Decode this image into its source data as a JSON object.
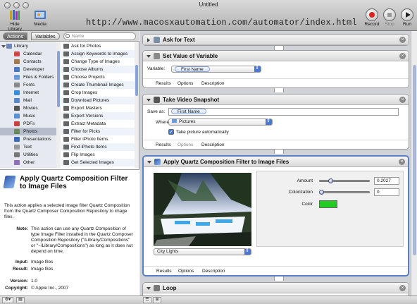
{
  "window": {
    "title": "Untitled"
  },
  "toolbar": {
    "hide_library_label": "Hide Library",
    "media_label": "Media",
    "url_text": "http://www.macosxautomation.com/automator/index.html",
    "record_label": "Record",
    "stop_label": "Stop",
    "run_label": "Run"
  },
  "library": {
    "tabs": {
      "actions": "Actions",
      "variables": "Variables"
    },
    "search_placeholder": "Name",
    "categories": [
      {
        "label": "Library",
        "icon": "library-icon",
        "color": "#6d88b8",
        "top": true
      },
      {
        "label": "Calendar",
        "icon": "calendar-icon",
        "color": "#d04545"
      },
      {
        "label": "Contacts",
        "icon": "contacts-icon",
        "color": "#a57a4e"
      },
      {
        "label": "Developer",
        "icon": "developer-icon",
        "color": "#4d78c0"
      },
      {
        "label": "Files & Folders",
        "icon": "folder-icon",
        "color": "#6a9ad8"
      },
      {
        "label": "Fonts",
        "icon": "fonts-icon",
        "color": "#888888"
      },
      {
        "label": "Internet",
        "icon": "internet-icon",
        "color": "#3a8ed8"
      },
      {
        "label": "Mail",
        "icon": "mail-icon",
        "color": "#5a87c8"
      },
      {
        "label": "Movies",
        "icon": "movies-icon",
        "color": "#555555"
      },
      {
        "label": "Music",
        "icon": "music-icon",
        "color": "#5a8fd0"
      },
      {
        "label": "PDFs",
        "icon": "pdf-icon",
        "color": "#c84040"
      },
      {
        "label": "Photos",
        "icon": "photos-icon",
        "color": "#6a8a5a",
        "selected": true
      },
      {
        "label": "Presentations",
        "icon": "presentations-icon",
        "color": "#3a6ab8"
      },
      {
        "label": "Text",
        "icon": "text-icon",
        "color": "#999999"
      },
      {
        "label": "Utilities",
        "icon": "utilities-icon",
        "color": "#777777"
      },
      {
        "label": "Other",
        "icon": "other-icon",
        "color": "#8f6fb8"
      }
    ],
    "actions": [
      "Ask for Photos",
      "Assign Keywords to Images",
      "Change Type of Images",
      "Choose Albums",
      "Choose Projects",
      "Create Thumbnail Images",
      "Crop Images",
      "Download Pictures",
      "Export Masters",
      "Export Versions",
      "Extract Metadata",
      "Filter for Picks",
      "Filter iPhoto Items",
      "Find iPhoto Items",
      "Flip Images",
      "Get Selected Images"
    ]
  },
  "description": {
    "title": "Apply Quartz Composition Filter to Image Files",
    "body": "This action applies a selected image filter Quartz Composition from the Quartz Composer Composition Repository to image files.",
    "note_label": "Note:",
    "note": "This action can use any Quartz Composition of type Image Filter installed in the Quartz Composer Composition Repository (\"/Library/Compositions\" or \"~/Library/Compositions\") as long as it does not depend on time.",
    "input_label": "Input:",
    "input": "Image files",
    "result_label": "Result:",
    "result": "Image files",
    "version_label": "Version:",
    "version": "1.0",
    "copyright_label": "Copyright:",
    "copyright": "© Apple Inc., 2007"
  },
  "workflow": {
    "footer_tabs": {
      "results": "Results",
      "options": "Options",
      "description": "Description"
    },
    "ask_for_text": {
      "title": "Ask for Text"
    },
    "set_variable": {
      "title": "Set Value of Variable",
      "variable_label": "Variable:",
      "variable_value": "First Name"
    },
    "take_snapshot": {
      "title": "Take Video Snapshot",
      "save_as_label": "Save as:",
      "save_as_value": "First Name",
      "where_label": "Where:",
      "where_value": "Pictures",
      "checkbox_label": "Take picture automatically",
      "checkbox_checked": true
    },
    "quartz_filter": {
      "title": "Apply Quartz Composition Filter to Image Files",
      "amount_label": "Amount",
      "amount_value": "0.2027",
      "amount_fraction": 0.2027,
      "colorization_label": "Colorization",
      "colorization_value": "0",
      "colorization_fraction": 0,
      "color_label": "Color",
      "color_swatch": "#22cc22",
      "filter_value": "City Lights"
    },
    "loop": {
      "title": "Loop"
    }
  }
}
